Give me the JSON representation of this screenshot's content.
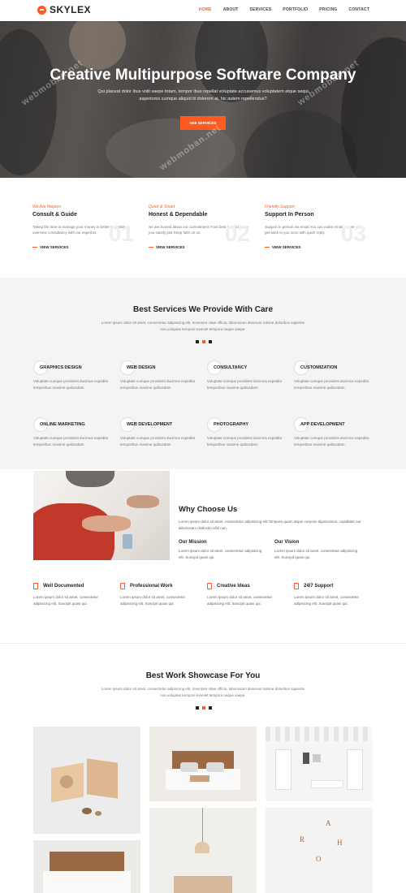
{
  "brand": {
    "name": "SKYLEX",
    "accent": "#ff5a1f"
  },
  "nav": {
    "items": [
      "HOME",
      "ABOUT",
      "SERVICES",
      "PORTFOLIO",
      "PRICING",
      "CONTACT"
    ],
    "active": "HOME"
  },
  "hero": {
    "title": "Creative Multipurpose Software Company",
    "text": "Qui placeat dolor ibus volit saepe totam, tempor ibus repellat voluptate accusamus voluptatem atque sequi asperiores cumque aliquid iti dolorem at, hic autem repellendus?",
    "button": "SEE SERVICES"
  },
  "features": [
    {
      "tag": "We Are Helpers",
      "title": "Consult & Guide",
      "text": "Taking the time to manage your money in better way.Make a overview consultancy with our expertist.",
      "number": "01",
      "link": "VIEW SERVICES"
    },
    {
      "tag": "Quick & Smart",
      "title": "Honest & Dependable",
      "text": "we are honest about our commitment.Trust best level to make you satisfy just Keep faith on us.",
      "number": "02",
      "link": "VIEW SERVICES"
    },
    {
      "tag": "Friendly Support",
      "title": "Support In Person",
      "text": "Support in person via email.You can make email us ,we will get back to you soon with quick reply.",
      "number": "03",
      "link": "VIEW SERVICES"
    }
  ],
  "services": {
    "title": "Best Services We Provide With Care",
    "subtitle": "Lorem ipsum dolor sit amet, consectetur adipisicing elit. Inventore vitae officia, laboriosam deserunt ratione doloribus sapiente non,voluptas tempore eveniet tempora neque saepe.",
    "items": [
      {
        "name": "GRAPHICS DESIGN",
        "text": "Voluptate cumque provident ducimus expedita temporibus maxime quibusdam"
      },
      {
        "name": "WEB DESIGN",
        "text": "Voluptate cumque provident ducimus expedita temporibus maxime quibusdam"
      },
      {
        "name": "CONSULTANCY",
        "text": "Voluptate cumque provident ducimus expedita temporibus maxime quibusdam"
      },
      {
        "name": "CUSTOMIZATION",
        "text": "Voluptate cumque provident ducimus expedita temporibus maxime quibusdam"
      },
      {
        "name": "ONLINE MARKETING",
        "text": "Voluptate cumque provident ducimus expedita temporibus maxime quibusdam"
      },
      {
        "name": "WEB DEVELOPMENT",
        "text": "Voluptate cumque provident ducimus expedita temporibus maxime quibusdam"
      },
      {
        "name": "PHOTOGRAPHY",
        "text": "Voluptate cumque provident ducimus expedita temporibus maxime quibusdam"
      },
      {
        "name": "APP DEVELOPMENT",
        "text": "Voluptate cumque provident ducimus expedita temporibus maxime quibusdam"
      }
    ]
  },
  "why": {
    "title": "Why Choose Us",
    "text": "Lorem ipsum dolor sit amet, consectetur adipisicing elit.Tempora quam atque corporis dignissimos, cupiditate aut laboriosam distinctio nihil non.",
    "mission": {
      "title": "Our Mission",
      "text": "Lorem ipsum dolor sit amet, consectetur adipisicing elit. Suscipit quasi qui."
    },
    "vision": {
      "title": "Our Vision",
      "text": "Lorem ipsum dolor sit amet, consectetur adipisicing elit. Suscipit quasi qui."
    }
  },
  "highlights": [
    {
      "title": "Well Documented",
      "text": "Lorem ipsum dolor sit amet, consectetur adipisicing elit. Suscipit quasi qui."
    },
    {
      "title": "Professional Work",
      "text": "Lorem ipsum dolor sit amet, consectetur adipisicing elit. Suscipit quasi qui."
    },
    {
      "title": "Creative Ideas",
      "text": "Lorem ipsum dolor sit amet, consectetur adipisicing elit. Suscipit quasi qui."
    },
    {
      "title": "24/7 Support",
      "text": "Lorem ipsum dolor sit amet, consectetur adipisicing elit. Suscipit quasi qui."
    }
  ],
  "showcase": {
    "title": "Best Work Showcase For You",
    "subtitle": "Lorem ipsum dolor sit amet, consectetur adipisicing elit. Inventore vitae officia, laboriosam deserunt ratione doloribus sapiente non,voluptas tempore eveniet tempora neque saepe.",
    "letters": [
      "A",
      "R",
      "H",
      "O"
    ]
  },
  "watermark": "webmoban.net"
}
